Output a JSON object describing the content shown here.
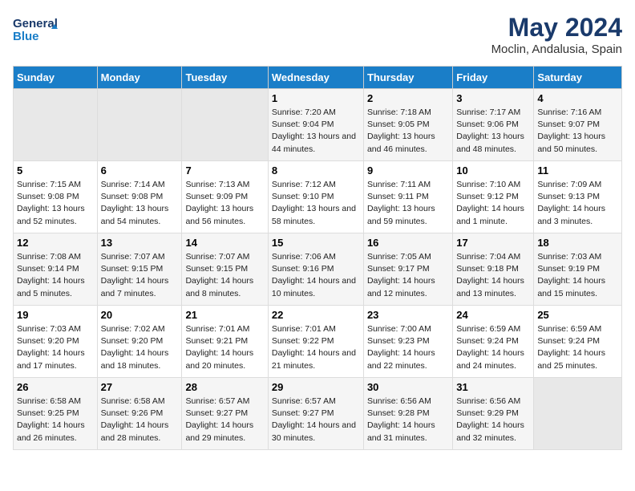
{
  "header": {
    "logo_line1": "General",
    "logo_line2": "Blue",
    "title": "May 2024",
    "subtitle": "Moclin, Andalusia, Spain"
  },
  "days_of_week": [
    "Sunday",
    "Monday",
    "Tuesday",
    "Wednesday",
    "Thursday",
    "Friday",
    "Saturday"
  ],
  "weeks": [
    {
      "cells": [
        {
          "day": null,
          "empty": true
        },
        {
          "day": null,
          "empty": true
        },
        {
          "day": null,
          "empty": true
        },
        {
          "day": "1",
          "sunrise": "Sunrise: 7:20 AM",
          "sunset": "Sunset: 9:04 PM",
          "daylight": "Daylight: 13 hours and 44 minutes."
        },
        {
          "day": "2",
          "sunrise": "Sunrise: 7:18 AM",
          "sunset": "Sunset: 9:05 PM",
          "daylight": "Daylight: 13 hours and 46 minutes."
        },
        {
          "day": "3",
          "sunrise": "Sunrise: 7:17 AM",
          "sunset": "Sunset: 9:06 PM",
          "daylight": "Daylight: 13 hours and 48 minutes."
        },
        {
          "day": "4",
          "sunrise": "Sunrise: 7:16 AM",
          "sunset": "Sunset: 9:07 PM",
          "daylight": "Daylight: 13 hours and 50 minutes."
        }
      ]
    },
    {
      "cells": [
        {
          "day": "5",
          "sunrise": "Sunrise: 7:15 AM",
          "sunset": "Sunset: 9:08 PM",
          "daylight": "Daylight: 13 hours and 52 minutes."
        },
        {
          "day": "6",
          "sunrise": "Sunrise: 7:14 AM",
          "sunset": "Sunset: 9:08 PM",
          "daylight": "Daylight: 13 hours and 54 minutes."
        },
        {
          "day": "7",
          "sunrise": "Sunrise: 7:13 AM",
          "sunset": "Sunset: 9:09 PM",
          "daylight": "Daylight: 13 hours and 56 minutes."
        },
        {
          "day": "8",
          "sunrise": "Sunrise: 7:12 AM",
          "sunset": "Sunset: 9:10 PM",
          "daylight": "Daylight: 13 hours and 58 minutes."
        },
        {
          "day": "9",
          "sunrise": "Sunrise: 7:11 AM",
          "sunset": "Sunset: 9:11 PM",
          "daylight": "Daylight: 13 hours and 59 minutes."
        },
        {
          "day": "10",
          "sunrise": "Sunrise: 7:10 AM",
          "sunset": "Sunset: 9:12 PM",
          "daylight": "Daylight: 14 hours and 1 minute."
        },
        {
          "day": "11",
          "sunrise": "Sunrise: 7:09 AM",
          "sunset": "Sunset: 9:13 PM",
          "daylight": "Daylight: 14 hours and 3 minutes."
        }
      ]
    },
    {
      "cells": [
        {
          "day": "12",
          "sunrise": "Sunrise: 7:08 AM",
          "sunset": "Sunset: 9:14 PM",
          "daylight": "Daylight: 14 hours and 5 minutes."
        },
        {
          "day": "13",
          "sunrise": "Sunrise: 7:07 AM",
          "sunset": "Sunset: 9:15 PM",
          "daylight": "Daylight: 14 hours and 7 minutes."
        },
        {
          "day": "14",
          "sunrise": "Sunrise: 7:07 AM",
          "sunset": "Sunset: 9:15 PM",
          "daylight": "Daylight: 14 hours and 8 minutes."
        },
        {
          "day": "15",
          "sunrise": "Sunrise: 7:06 AM",
          "sunset": "Sunset: 9:16 PM",
          "daylight": "Daylight: 14 hours and 10 minutes."
        },
        {
          "day": "16",
          "sunrise": "Sunrise: 7:05 AM",
          "sunset": "Sunset: 9:17 PM",
          "daylight": "Daylight: 14 hours and 12 minutes."
        },
        {
          "day": "17",
          "sunrise": "Sunrise: 7:04 AM",
          "sunset": "Sunset: 9:18 PM",
          "daylight": "Daylight: 14 hours and 13 minutes."
        },
        {
          "day": "18",
          "sunrise": "Sunrise: 7:03 AM",
          "sunset": "Sunset: 9:19 PM",
          "daylight": "Daylight: 14 hours and 15 minutes."
        }
      ]
    },
    {
      "cells": [
        {
          "day": "19",
          "sunrise": "Sunrise: 7:03 AM",
          "sunset": "Sunset: 9:20 PM",
          "daylight": "Daylight: 14 hours and 17 minutes."
        },
        {
          "day": "20",
          "sunrise": "Sunrise: 7:02 AM",
          "sunset": "Sunset: 9:20 PM",
          "daylight": "Daylight: 14 hours and 18 minutes."
        },
        {
          "day": "21",
          "sunrise": "Sunrise: 7:01 AM",
          "sunset": "Sunset: 9:21 PM",
          "daylight": "Daylight: 14 hours and 20 minutes."
        },
        {
          "day": "22",
          "sunrise": "Sunrise: 7:01 AM",
          "sunset": "Sunset: 9:22 PM",
          "daylight": "Daylight: 14 hours and 21 minutes."
        },
        {
          "day": "23",
          "sunrise": "Sunrise: 7:00 AM",
          "sunset": "Sunset: 9:23 PM",
          "daylight": "Daylight: 14 hours and 22 minutes."
        },
        {
          "day": "24",
          "sunrise": "Sunrise: 6:59 AM",
          "sunset": "Sunset: 9:24 PM",
          "daylight": "Daylight: 14 hours and 24 minutes."
        },
        {
          "day": "25",
          "sunrise": "Sunrise: 6:59 AM",
          "sunset": "Sunset: 9:24 PM",
          "daylight": "Daylight: 14 hours and 25 minutes."
        }
      ]
    },
    {
      "cells": [
        {
          "day": "26",
          "sunrise": "Sunrise: 6:58 AM",
          "sunset": "Sunset: 9:25 PM",
          "daylight": "Daylight: 14 hours and 26 minutes."
        },
        {
          "day": "27",
          "sunrise": "Sunrise: 6:58 AM",
          "sunset": "Sunset: 9:26 PM",
          "daylight": "Daylight: 14 hours and 28 minutes."
        },
        {
          "day": "28",
          "sunrise": "Sunrise: 6:57 AM",
          "sunset": "Sunset: 9:27 PM",
          "daylight": "Daylight: 14 hours and 29 minutes."
        },
        {
          "day": "29",
          "sunrise": "Sunrise: 6:57 AM",
          "sunset": "Sunset: 9:27 PM",
          "daylight": "Daylight: 14 hours and 30 minutes."
        },
        {
          "day": "30",
          "sunrise": "Sunrise: 6:56 AM",
          "sunset": "Sunset: 9:28 PM",
          "daylight": "Daylight: 14 hours and 31 minutes."
        },
        {
          "day": "31",
          "sunrise": "Sunrise: 6:56 AM",
          "sunset": "Sunset: 9:29 PM",
          "daylight": "Daylight: 14 hours and 32 minutes."
        },
        {
          "day": null,
          "empty": true
        }
      ]
    }
  ]
}
